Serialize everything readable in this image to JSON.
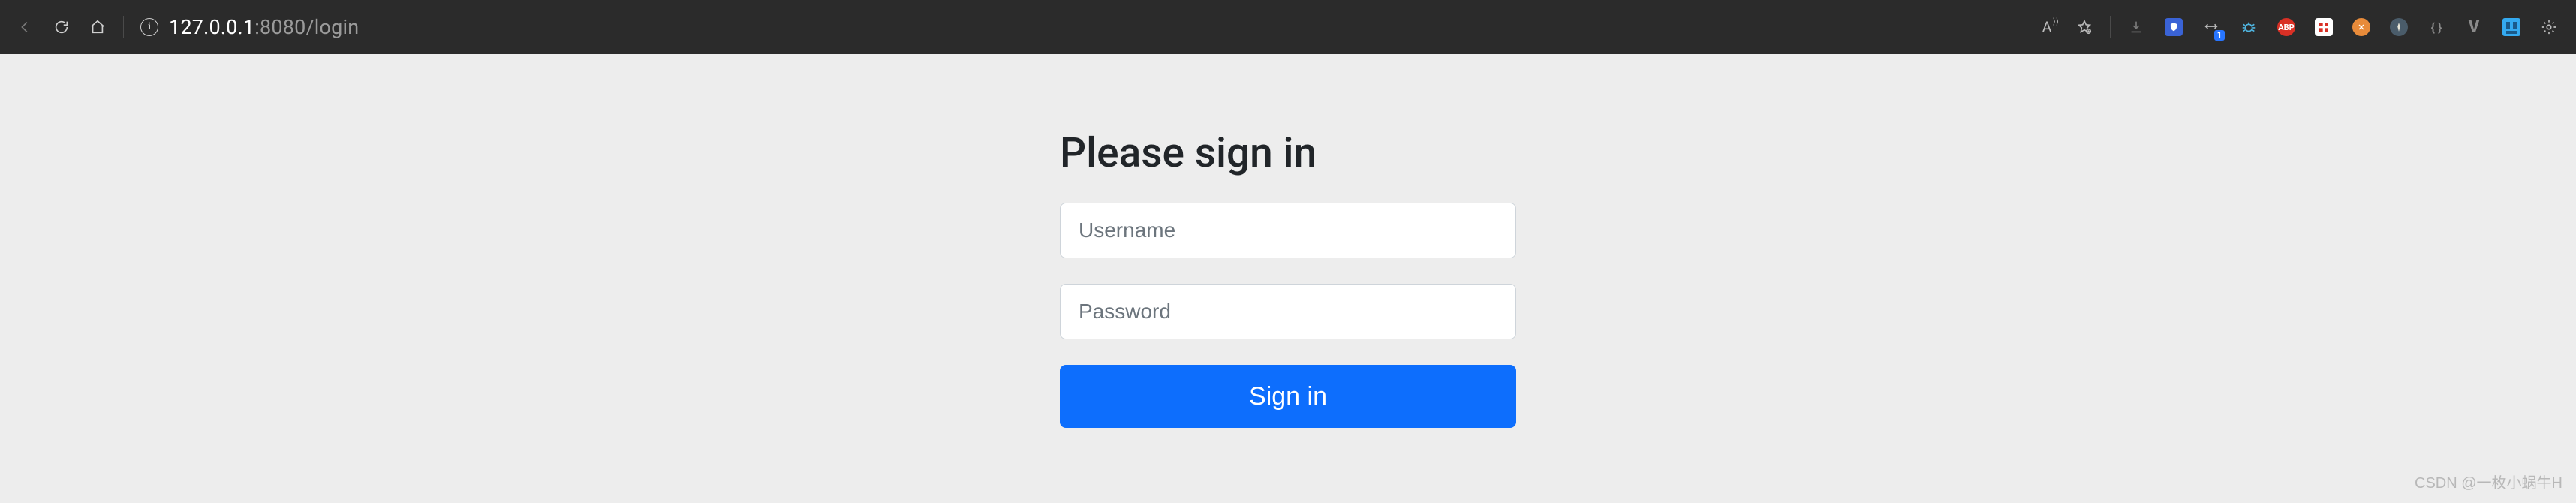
{
  "chrome": {
    "url_host": "127.0.0.1",
    "url_rest": ":8080/login",
    "read_aloud_label": "A",
    "ext_badge_1": "1",
    "ext_abp": "ABP",
    "ext_v": "V",
    "ext_braces": "{ }"
  },
  "form": {
    "title": "Please sign in",
    "username_placeholder": "Username",
    "password_placeholder": "Password",
    "submit_label": "Sign in"
  },
  "watermark": "CSDN @一枚小蜗牛H"
}
